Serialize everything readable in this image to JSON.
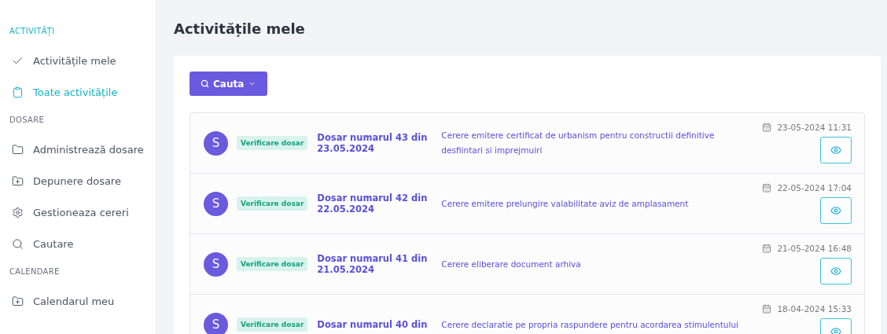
{
  "sidebar": {
    "sections": [
      {
        "heading": "ACTIVITĂȚI",
        "items": [
          {
            "label": "Activitățile mele",
            "selected": false
          },
          {
            "label": "Toate activitățile",
            "selected": true
          }
        ]
      },
      {
        "heading": "DOSARE",
        "items": [
          {
            "label": "Administrează dosare",
            "selected": false
          },
          {
            "label": "Depunere dosare",
            "selected": false
          },
          {
            "label": "Gestioneaza cereri",
            "selected": false
          },
          {
            "label": "Cautare",
            "selected": false
          }
        ]
      },
      {
        "heading": "CALENDARE",
        "items": [
          {
            "label": "Calendarul meu",
            "selected": false
          }
        ]
      }
    ]
  },
  "page_title": "Activitățile mele",
  "search_button": "Cauta",
  "activities": [
    {
      "avatar": "S",
      "badge": "Verificare dosar",
      "title": "Dosar numarul 43 din 23.05.2024",
      "description": "Cerere emitere certificat de urbanism pentru constructii definitive desfiintari si imprejmuiri",
      "date": "23-05-2024 11:31"
    },
    {
      "avatar": "S",
      "badge": "Verificare dosar",
      "title": "Dosar numarul 42 din 22.05.2024",
      "description": "Cerere emitere prelungire valabilitate aviz de amplasament",
      "date": "22-05-2024 17:04"
    },
    {
      "avatar": "S",
      "badge": "Verificare dosar",
      "title": "Dosar numarul 41 din 21.05.2024",
      "description": "Cerere eliberare document arhiva",
      "date": "21-05-2024 16:48"
    },
    {
      "avatar": "S",
      "badge": "Verificare dosar",
      "title": "Dosar numarul 40 din",
      "description": "Cerere declaratie pe propria raspundere pentru acordarea stimulentului",
      "date": "18-04-2024 15:33"
    }
  ]
}
